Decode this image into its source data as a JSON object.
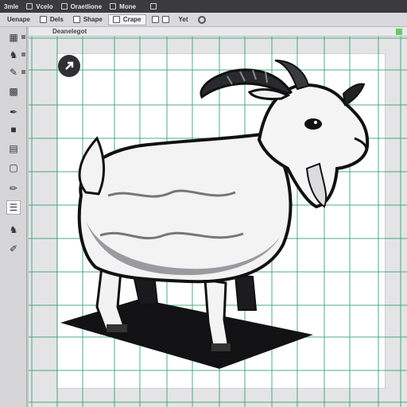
{
  "menubar": {
    "items": [
      {
        "label": "3mle"
      },
      {
        "label": "Vcelo"
      },
      {
        "label": "Oraetlione"
      },
      {
        "label": "Mone"
      }
    ]
  },
  "toolbar": {
    "tabs": [
      {
        "label": "Uenape"
      },
      {
        "label": "Dels"
      },
      {
        "label": "Shape"
      },
      {
        "label": "Crape"
      },
      {
        "label": "Yet"
      }
    ],
    "active_tab": "Crape"
  },
  "document": {
    "title": "Deanelegot"
  },
  "canvas": {
    "grid_color": "#2f9e6a",
    "subject": "goat-illustration"
  },
  "icons": {
    "overlay": "expand-arrow-icon"
  }
}
